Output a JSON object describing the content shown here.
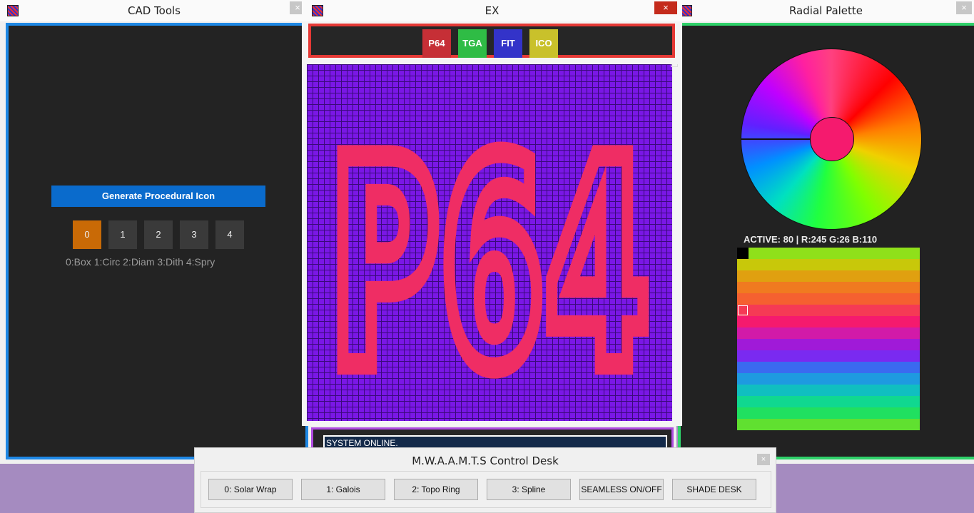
{
  "windows": {
    "cad": {
      "title": "CAD Tools",
      "close": "×",
      "generate_label": "Generate Procedural Icon",
      "brushes": [
        "0",
        "1",
        "2",
        "3",
        "4"
      ],
      "active_brush": 0,
      "brush_legend": "0:Box 1:Circ 2:Diam 3:Dith 4:Spry"
    },
    "ex": {
      "title": "EX",
      "close": "×",
      "formats": [
        {
          "label": "P64",
          "color": "#c62f36"
        },
        {
          "label": "TGA",
          "color": "#2fbc45"
        },
        {
          "label": "FIT",
          "color": "#3333c9"
        },
        {
          "label": "ICO",
          "color": "#c9c12b"
        }
      ],
      "canvas_text": "P64",
      "canvas_bg": "#7a17e6",
      "canvas_fg": "#ef2d64"
    },
    "radial": {
      "title": "Radial Palette",
      "close": "×",
      "active_readout": "ACTIVE: 80 | R:245 G:26 B:110",
      "active_color": "#f51a6e",
      "palette_rows": [
        "#8fe01a",
        "#c8c80a",
        "#e0a010",
        "#f07a20",
        "#f56030",
        "#f53a55",
        "#f51a6e",
        "#d21aa8",
        "#a01ad8",
        "#7a2af0",
        "#3a6af0",
        "#1e9ae0",
        "#10bfc0",
        "#10d890",
        "#20e060",
        "#60e030"
      ]
    },
    "log": {
      "text": "SYSTEM ONLINE."
    },
    "desk": {
      "title": "M.W.A.A.M.T.S Control Desk",
      "close": "×",
      "buttons": [
        "0: Solar Wrap",
        "1: Galois",
        "2: Topo Ring",
        "3: Spline",
        "SEAMLESS ON/OFF",
        "SHADE DESK"
      ]
    }
  }
}
